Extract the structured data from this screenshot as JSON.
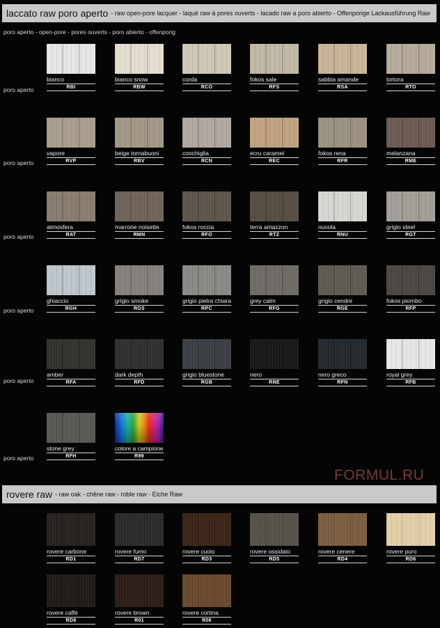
{
  "section1": {
    "title": "laccato raw poro aperto",
    "subtitle": "- raw open-pore lacquer - laqué raw à pores ouverts - lacado raw a poro abierto - Offenporige Lackausführung Raw",
    "subline": "poro aperto - open-pore - pores ouverts - poro abierto - offenporig",
    "row_labels": [
      "poro aperto",
      "poro aperto",
      "poro aperto",
      "poro aperto",
      "poro aperto",
      "poro aperto"
    ],
    "swatches": [
      {
        "name": "bianco",
        "code": "RBI",
        "color": "#e6e6e4"
      },
      {
        "name": "bianco snow",
        "code": "RBW",
        "color": "#e4ddd0"
      },
      {
        "name": "corda",
        "code": "RCO",
        "color": "#cfc8b6"
      },
      {
        "name": "fokos sale",
        "code": "RFS",
        "color": "#c2b8a6"
      },
      {
        "name": "sabbia amande",
        "code": "RSA",
        "color": "#c9b497"
      },
      {
        "name": "tortora",
        "code": "RTO",
        "color": "#b6ab9a"
      },
      {
        "name": "vapore",
        "code": "RVP",
        "color": "#a99e90"
      },
      {
        "name": "beige tornabuoni",
        "code": "RBV",
        "color": "#a39886"
      },
      {
        "name": "conchiglia",
        "code": "RCN",
        "color": "#b2a8a2"
      },
      {
        "name": "ecru caramel",
        "code": "REC",
        "color": "#c0a47f"
      },
      {
        "name": "fokos rena",
        "code": "RFR",
        "color": "#9c9282"
      },
      {
        "name": "melanzana",
        "code": "RME",
        "color": "#6b5b53"
      },
      {
        "name": "atmosfera",
        "code": "RAT",
        "color": "#8b7c70"
      },
      {
        "name": "marrone noisette",
        "code": "RMN",
        "color": "#6f6459"
      },
      {
        "name": "fokos roccia",
        "code": "RFO",
        "color": "#5e564c"
      },
      {
        "name": "terra amazzon",
        "code": "RTZ",
        "color": "#564d43"
      },
      {
        "name": "nuvola",
        "code": "RNU",
        "color": "#d6d6d2"
      },
      {
        "name": "grigio steel",
        "code": "RGT",
        "color": "#a29f99"
      },
      {
        "name": "ghiaccio",
        "code": "RGH",
        "color": "#bfc6cc"
      },
      {
        "name": "grigio smoke",
        "code": "RGS",
        "color": "#85827d"
      },
      {
        "name": "grigio pietra chiara",
        "code": "RPC",
        "color": "#8b8985"
      },
      {
        "name": "grey calm",
        "code": "RFG",
        "color": "#6f6c66"
      },
      {
        "name": "grigio cendre",
        "code": "RGE",
        "color": "#5f5b53"
      },
      {
        "name": "fokos piombo",
        "code": "RFP",
        "color": "#4b4844"
      },
      {
        "name": "amber",
        "code": "RFA",
        "color": "#33322d"
      },
      {
        "name": "dark depth",
        "code": "RFD",
        "color": "#2f3032"
      },
      {
        "name": "grigio bluestone",
        "code": "RGB",
        "color": "#3b3f44"
      },
      {
        "name": "nero",
        "code": "RNE",
        "color": "#1a1718"
      },
      {
        "name": "nero greco",
        "code": "RFN",
        "color": "#23292d"
      },
      {
        "name": "royal grey",
        "code": "RFB",
        "color": "#e6e6e4"
      },
      {
        "name": "stone grey",
        "code": "RFH",
        "color": "#595855"
      },
      {
        "name": "colore a campione",
        "code": "R99",
        "color": "rainbow"
      }
    ]
  },
  "section2": {
    "title": "rovere raw",
    "subtitle": "- raw oak - chêne raw - roble raw - Eiche Raw",
    "swatches": [
      {
        "name": "rovere carbone",
        "code": "RD1",
        "color": "#26221d"
      },
      {
        "name": "rovere fumo",
        "code": "RD7",
        "color": "#2a2b2c"
      },
      {
        "name": "rovere cuoio",
        "code": "RD3",
        "color": "#3a2618"
      },
      {
        "name": "rovere ossidato",
        "code": "RD5",
        "color": "#56514a"
      },
      {
        "name": "rovere cenere",
        "code": "RD4",
        "color": "#7a5e42"
      },
      {
        "name": "rovere puro",
        "code": "RD6",
        "color": "#e2cfa8"
      },
      {
        "name": "rovere caffé",
        "code": "RD8",
        "color": "#201b18"
      },
      {
        "name": "rovere brown",
        "code": "R01",
        "color": "#2d1e18"
      },
      {
        "name": "rovere cortina",
        "code": "R06",
        "color": "#6a4a2e"
      }
    ]
  },
  "watermark": "FORMUL.RU"
}
